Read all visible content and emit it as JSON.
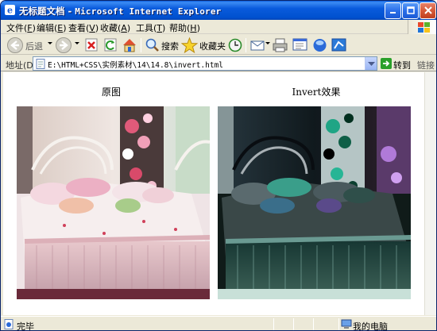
{
  "window": {
    "title_cn": "无标题文档",
    "title_sep": " - ",
    "title_app": "Microsoft Internet Explorer"
  },
  "menu": [
    {
      "label": "文件(",
      "key": "F",
      "end": ")"
    },
    {
      "label": "编辑(",
      "key": "E",
      "end": ")"
    },
    {
      "label": "查看(",
      "key": "V",
      "end": ")"
    },
    {
      "label": "收藏(",
      "key": "A",
      "end": ")"
    },
    {
      "label": "工具(",
      "key": "T",
      "end": ")"
    },
    {
      "label": "帮助(",
      "key": "H",
      "end": ")"
    }
  ],
  "toolbar": {
    "back": "后退",
    "search": "搜索",
    "favorites": "收藏夹"
  },
  "address": {
    "label": "地址(D)",
    "url": "E:\\HTML+CSS\\实例素材\\14\\14.8\\invert.html",
    "go": "转到",
    "links": "链接"
  },
  "page": {
    "left_caption": "原图",
    "right_caption": "Invert效果"
  },
  "status": {
    "text": "完毕",
    "zone": "我的电脑"
  },
  "colors": {
    "titlebar": "#0a5bdc",
    "chrome": "#ece9d8"
  }
}
